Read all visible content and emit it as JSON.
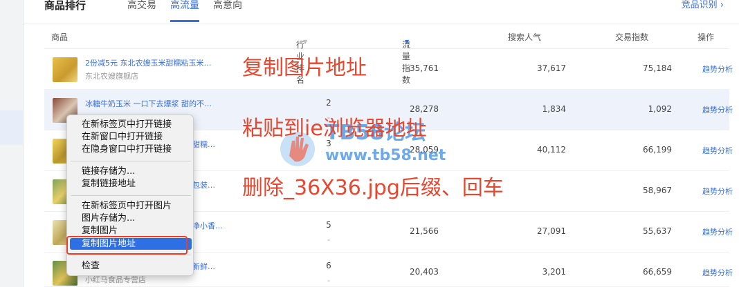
{
  "header": {
    "title": "商品排行",
    "tabs": [
      {
        "label": "高交易",
        "active": false
      },
      {
        "label": "高流量",
        "active": true
      },
      {
        "label": "高意向",
        "active": false
      }
    ],
    "right_link": "竞品识别 ›"
  },
  "table": {
    "columns": [
      "商品",
      "行业排名",
      "流量指数",
      "搜索人气",
      "交易指数",
      "操作"
    ],
    "rows": [
      {
        "name": "2份减5元 东北农嫂玉米甜糯粘玉米…",
        "shop": "东北农嫂旗舰店",
        "rank": "",
        "rank_change": "",
        "traffic": "35,761",
        "search": "37,617",
        "trade": "75,184",
        "action": "趋势分析"
      },
      {
        "name": "冰糖牛奶玉米 一口下去爆浆 甜的不…",
        "shop": "",
        "rank": "2",
        "rank_change": "-",
        "traffic": "28,278",
        "search": "1,834",
        "trade": "1,092",
        "action": "趋势分析"
      },
      {
        "name": "甜糯…",
        "shop": "",
        "rank": "3",
        "rank_change": "-",
        "traffic": "28,059",
        "search": "40,112",
        "trade": "66,199",
        "action": "趋势分析"
      },
      {
        "name": "包装…",
        "shop": "",
        "rank": "",
        "rank_change": "",
        "traffic": "",
        "search": "",
        "trade": "58,967",
        "action": "趋势分析"
      },
      {
        "name": "净小香…",
        "shop": "",
        "rank": "5",
        "rank_change": "-",
        "traffic": "21,566",
        "search": "27,091",
        "trade": "55,637",
        "action": "趋势分析"
      },
      {
        "name": "新鲜…",
        "shop": "小红马食品专营店",
        "rank": "6",
        "rank_change": "-",
        "traffic": "20,403",
        "search": "3,201",
        "trade": "66,659",
        "action": "趋势分析"
      }
    ]
  },
  "context_menu": {
    "items": [
      "在新标签页中打开链接",
      "在新窗口中打开链接",
      "在隐身窗口中打开链接",
      "链接存储为...",
      "复制链接地址",
      "在新标签页中打开图片",
      "图片存储为...",
      "复制图片",
      "复制图片地址",
      "检查"
    ]
  },
  "annotations": {
    "step1": "复制图片地址",
    "step2": "粘贴到ie浏览器地址",
    "step3": "删除_36X36.jpg后缀、回车"
  },
  "watermark": {
    "line1": "TB58论坛",
    "line2": "www.tb58.net"
  },
  "colors": {
    "accent": "#3a6fd8",
    "annotation": "#e8472f",
    "menu_selected": "#2f6fe4"
  }
}
